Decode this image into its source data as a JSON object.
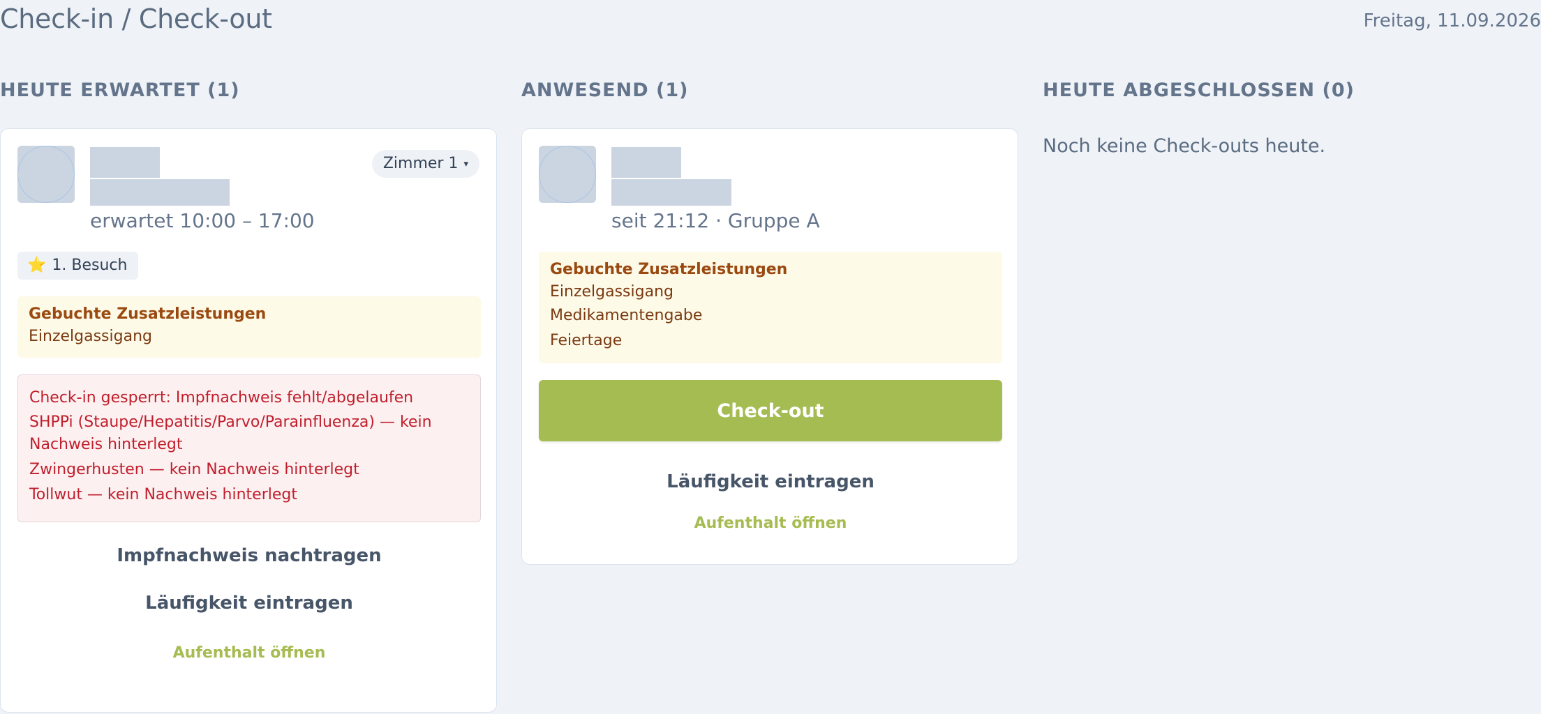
{
  "header": {
    "title": "Check-in / Check-out",
    "date": "Freitag, 11.09.2026"
  },
  "expected": {
    "heading": "HEUTE ERWARTET (1)",
    "card": {
      "time": "erwartet 10:00 – 17:00",
      "room": "Zimmer 1",
      "room_caret": "▾",
      "visit_icon": "⭐",
      "visit_badge": "1. Besuch",
      "services_title": "Gebuchte Zusatzleistungen",
      "services": [
        "Einzelgassigang"
      ],
      "alert_title": "Check-in gesperrt: Impfnachweis fehlt/abgelaufen",
      "alerts": [
        "SHPPi (Staupe/Hepatitis/Parvo/Parainfluenza) — kein Nachweis hinterlegt",
        "Zwingerhusten — kein Nachweis hinterlegt",
        "Tollwut — kein Nachweis hinterlegt"
      ],
      "btn_vaccination": "Impfnachweis nachtragen",
      "btn_heat": "Läufigkeit eintragen",
      "link_open": "Aufenthalt öffnen"
    }
  },
  "present": {
    "heading": "ANWESEND (1)",
    "card": {
      "time": "seit 21:12 · Gruppe A",
      "services_title": "Gebuchte Zusatzleistungen",
      "services": [
        "Einzelgassigang",
        "Medikamentengabe",
        "Feiertage"
      ],
      "btn_checkout": "Check-out",
      "btn_heat": "Läufigkeit eintragen",
      "link_open": "Aufenthalt öffnen"
    }
  },
  "completed": {
    "heading": "HEUTE ABGESCHLOSSEN (0)",
    "empty": "Noch keine Check-outs heute."
  },
  "colors": {
    "accent_green": "#a5bc52",
    "warning_brown": "#9a4a10",
    "alert_red": "#c01f2c",
    "background": "#eff3f8"
  }
}
